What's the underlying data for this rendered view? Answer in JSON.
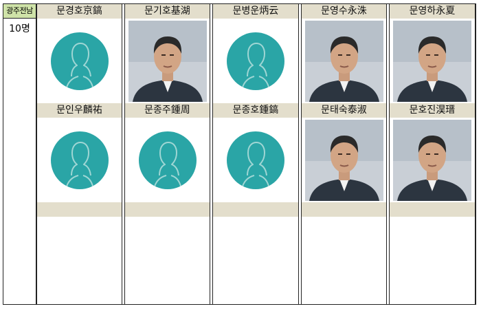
{
  "region": {
    "label": "광주전남",
    "count": "10명"
  },
  "columns": [
    {
      "top": {
        "name": "문경호京鎬",
        "photo": "placeholder"
      },
      "bottom": {
        "name": "문인우麟祐",
        "photo": "placeholder"
      }
    },
    {
      "top": {
        "name": "문기호基湖",
        "photo": "portrait"
      },
      "bottom": {
        "name": "문종주鍾周",
        "photo": "placeholder"
      }
    },
    {
      "top": {
        "name": "문병운炳云",
        "photo": "placeholder"
      },
      "bottom": {
        "name": "문종호鍾鎬",
        "photo": "placeholder"
      }
    },
    {
      "top": {
        "name": "문영수永洙",
        "photo": "portrait"
      },
      "bottom": {
        "name": "문태숙泰淑",
        "photo": "portrait"
      }
    },
    {
      "top": {
        "name": "문영하永夏",
        "photo": "portrait"
      },
      "bottom": {
        "name": "문호진淏瑨",
        "photo": "portrait"
      }
    }
  ]
}
